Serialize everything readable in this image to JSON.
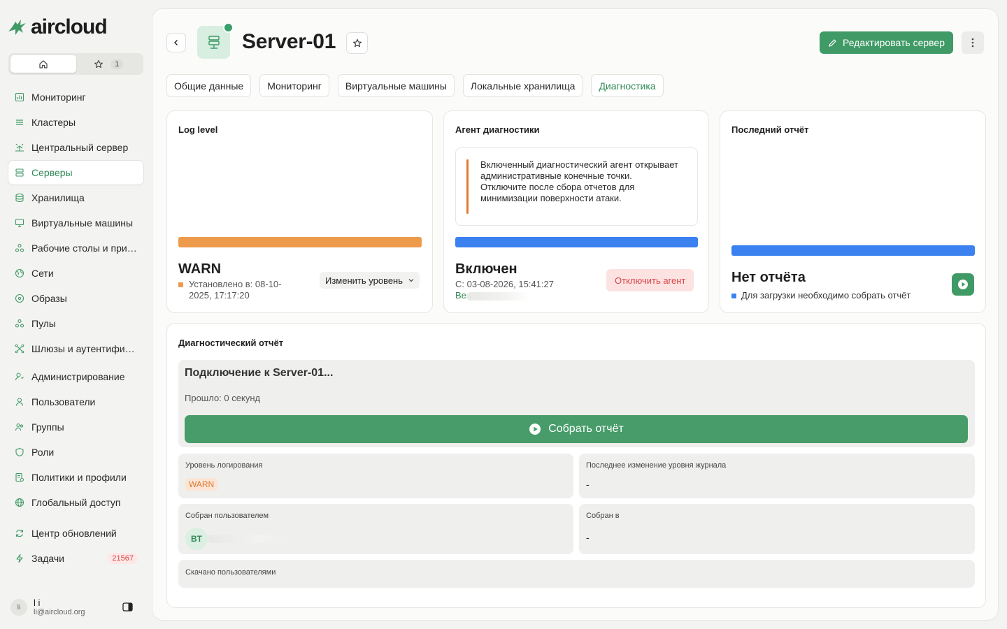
{
  "brand": {
    "name": "aircloud",
    "accent": "#3f9a66"
  },
  "quicktabs": {
    "home_icon": "home-icon",
    "star_icon": "star-icon",
    "fav_count": "1"
  },
  "nav": [
    {
      "label": "Мониторинг",
      "icon": "chart-icon"
    },
    {
      "label": "Кластеры",
      "icon": "layers-icon"
    },
    {
      "label": "Центральный сервер",
      "icon": "hub-icon"
    },
    {
      "label": "Серверы",
      "icon": "server-icon",
      "active": true
    },
    {
      "label": "Хранилища",
      "icon": "database-icon"
    },
    {
      "label": "Виртуальные машины",
      "icon": "monitor-icon"
    },
    {
      "label": "Рабочие столы и прил...",
      "icon": "apps-icon"
    },
    {
      "label": "Сети",
      "icon": "globe-icon"
    },
    {
      "label": "Образы",
      "icon": "disc-icon"
    },
    {
      "label": "Пулы",
      "icon": "pools-icon"
    },
    {
      "label": "Шлюзы и аутентифика...",
      "icon": "gateway-icon"
    },
    {
      "label": "Администрирование",
      "icon": "admin-icon"
    },
    {
      "label": "Пользователи",
      "icon": "user-icon"
    },
    {
      "label": "Группы",
      "icon": "group-icon"
    },
    {
      "label": "Роли",
      "icon": "shield-icon"
    },
    {
      "label": "Политики и профили",
      "icon": "policy-icon"
    },
    {
      "label": "Глобальный доступ",
      "icon": "world-icon"
    },
    {
      "label": "Центр обновлений",
      "icon": "refresh-icon"
    },
    {
      "label": "Задачи",
      "icon": "bolt-icon",
      "badge": "21567"
    }
  ],
  "user": {
    "initials": "li",
    "name": "l i",
    "email": "li@aircloud.org"
  },
  "header": {
    "title": "Server-01",
    "edit_label": "Редактировать сервер"
  },
  "tabs": [
    {
      "label": "Общие данные"
    },
    {
      "label": "Мониторинг"
    },
    {
      "label": "Виртуальные машины"
    },
    {
      "label": "Локальные хранилища"
    },
    {
      "label": "Диагностика",
      "active": true
    }
  ],
  "log_level": {
    "title": "Log level",
    "value": "WARN",
    "set_at": "Установлено в: 08-10-2025, 17:17:20",
    "change_label": "Изменить уровень",
    "color": "#ee9a4c"
  },
  "agent": {
    "title": "Агент диагностики",
    "alert": "Включенный диагностический агент открывает административные конечные точки.\nОтключите после сбора отчетов для минимизации поверхности атаки.",
    "status": "Включен",
    "since": "С: 03-08-2026, 15:41:27",
    "by_prefix": "Be",
    "disable_label": "Отключить агент",
    "color": "#3b82f0"
  },
  "last_report": {
    "title": "Последний отчёт",
    "status": "Нет отчёта",
    "hint": "Для загрузки необходимо собрать отчёт",
    "color": "#3b82f0"
  },
  "diag": {
    "title": "Диагностический отчёт",
    "connecting": "Подключение к Server-01...",
    "elapsed": "Прошло: 0 секунд",
    "collect_label": "Собрать отчёт",
    "log_level_label": "Уровень логирования",
    "log_level_value": "WARN",
    "last_change_label": "Последнее изменение уровня журнала",
    "last_change_value": "-",
    "collected_by_label": "Собран пользователем",
    "collected_by_initials": "BT",
    "collected_at_label": "Собран в",
    "collected_at_value": "-",
    "downloaded_by_label": "Скачано пользователями"
  }
}
